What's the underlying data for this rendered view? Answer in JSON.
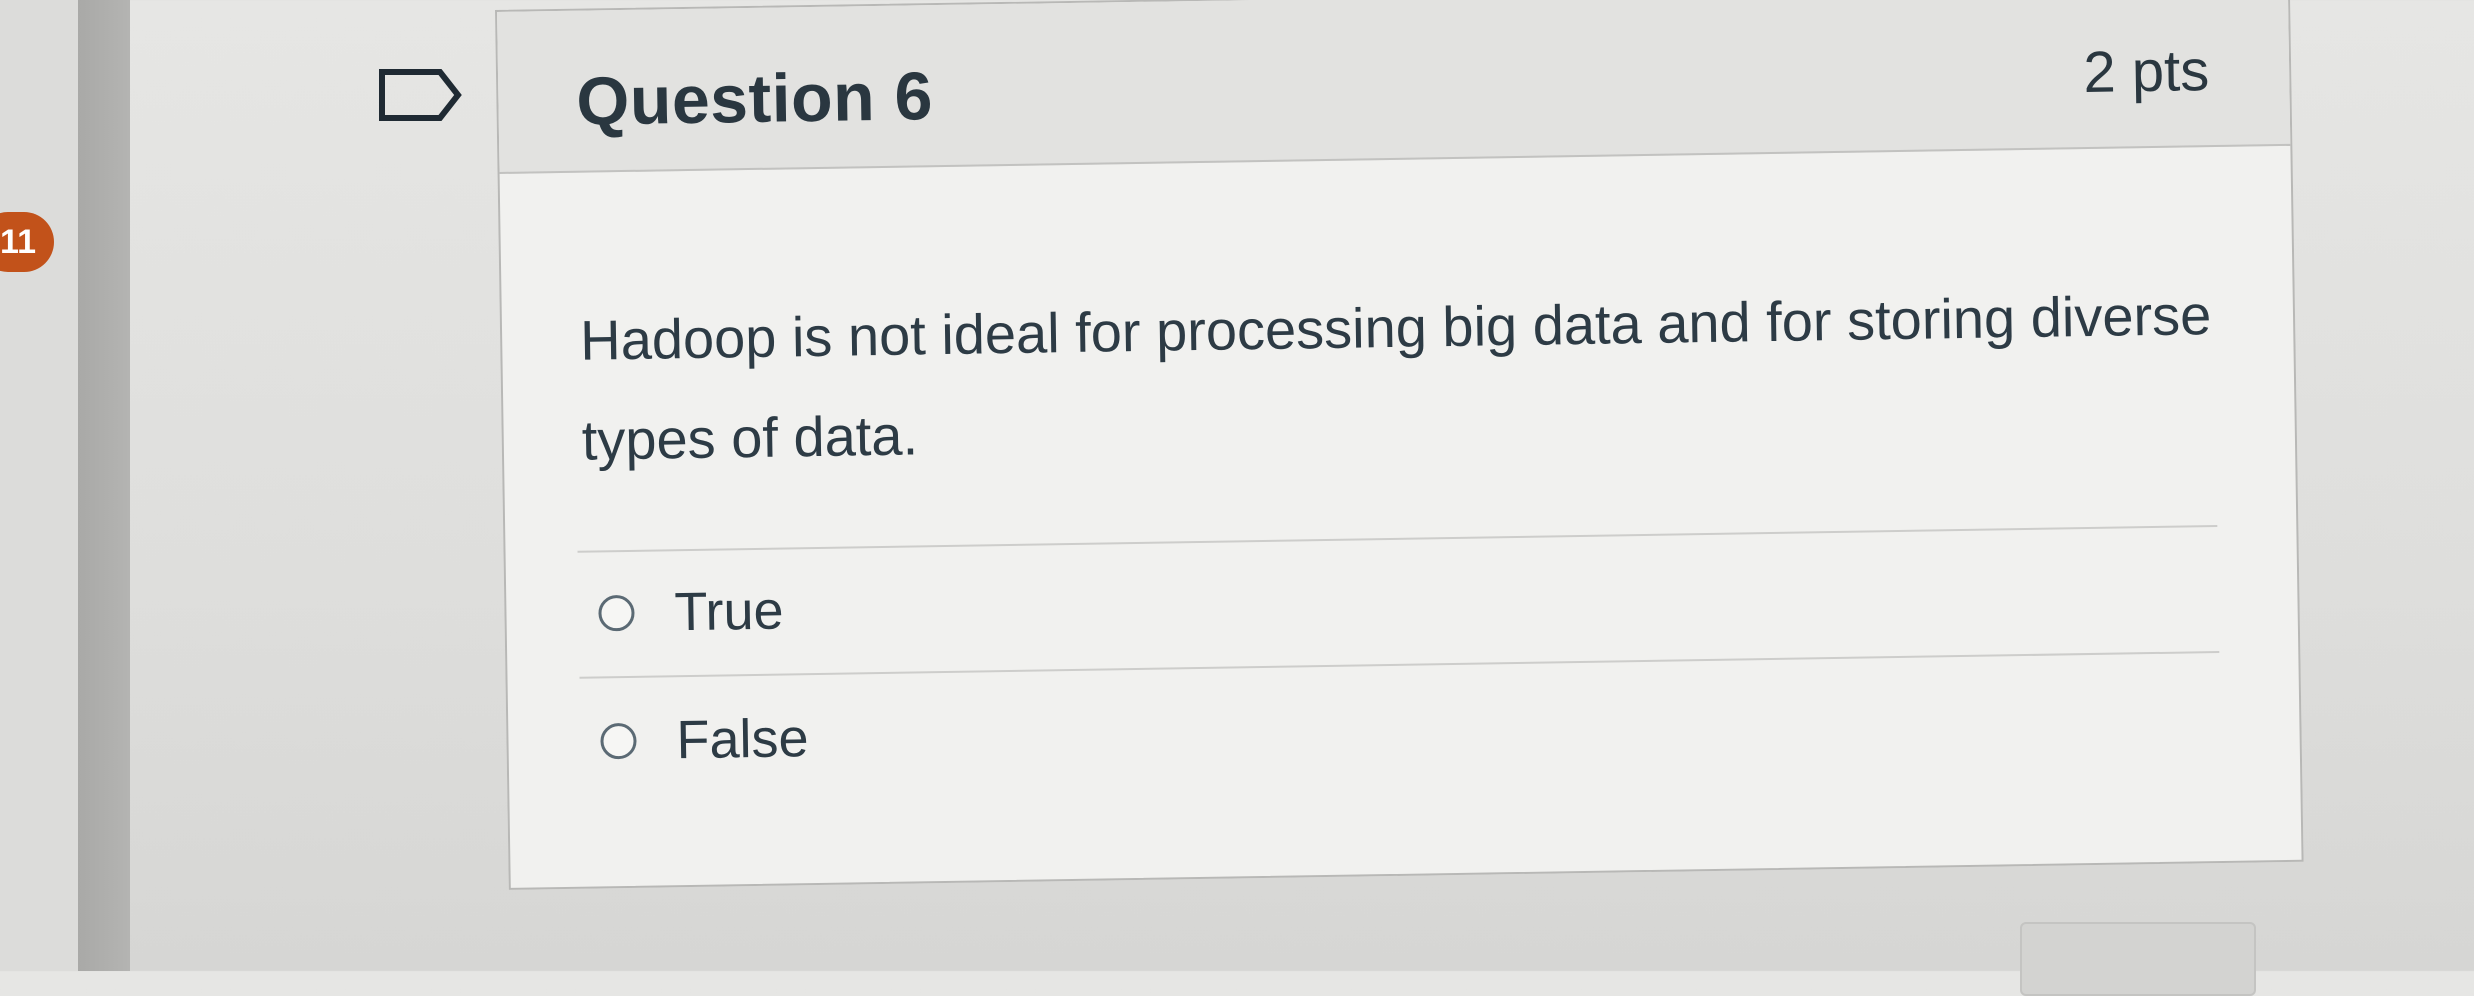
{
  "sidebar": {
    "badge_count": "11"
  },
  "question": {
    "flag_icon": "flag-icon",
    "title": "Question 6",
    "points": "2 pts",
    "text": "Hadoop is not ideal for processing big data and for storing diverse types of data.",
    "answers": [
      {
        "label": "True",
        "selected": false
      },
      {
        "label": "False",
        "selected": false
      }
    ]
  }
}
